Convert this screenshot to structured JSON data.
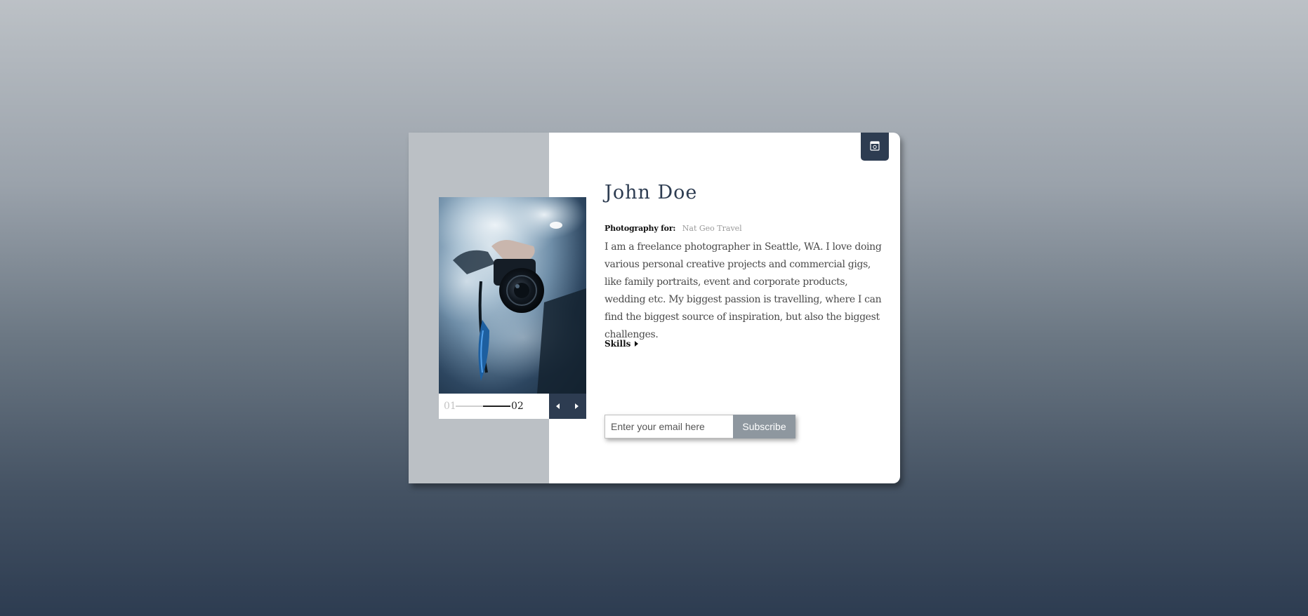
{
  "profile": {
    "name": "John Doe",
    "work_label": "Photography for:",
    "work_value": "Nat Geo Travel",
    "bio": "I am a freelance photographer in Seattle, WA. I love doing various personal creative projects and commercial gigs, like family portraits, event and corporate products, wedding etc. My biggest passion is travelling, where I can find the biggest source of inspiration, but also the biggest challenges.",
    "skills_label": "Skills"
  },
  "slider": {
    "current": "01",
    "total": "02",
    "progress": 0.5,
    "prev_icon": "triangle-left-icon",
    "next_icon": "triangle-right-icon"
  },
  "corner_button": {
    "icon": "calendar-icon"
  },
  "subscribe": {
    "placeholder": "Enter your email here",
    "button_label": "Subscribe"
  },
  "colors": {
    "accent": "#2d3c51",
    "side_panel": "#bbc0c5",
    "subscribe_button": "#8e979f",
    "muted_text": "#9a9a9a"
  }
}
